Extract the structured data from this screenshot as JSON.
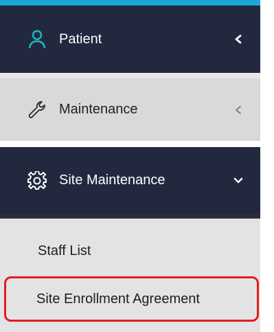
{
  "menu": {
    "patient": {
      "label": "Patient",
      "icon": "user-outline-icon",
      "chevron": "chevron-left-icon",
      "accent": "#1fb7c1"
    },
    "maintenance": {
      "label": "Maintenance",
      "icon": "wrench-icon",
      "chevron": "chevron-left-icon"
    },
    "site_maintenance": {
      "label": "Site Maintenance",
      "icon": "gear-icon",
      "chevron": "chevron-down-icon",
      "submenu": [
        {
          "label": "Staff List"
        },
        {
          "label": "Site Enrollment Agreement",
          "highlight_color": "#e61b1b"
        }
      ]
    }
  }
}
